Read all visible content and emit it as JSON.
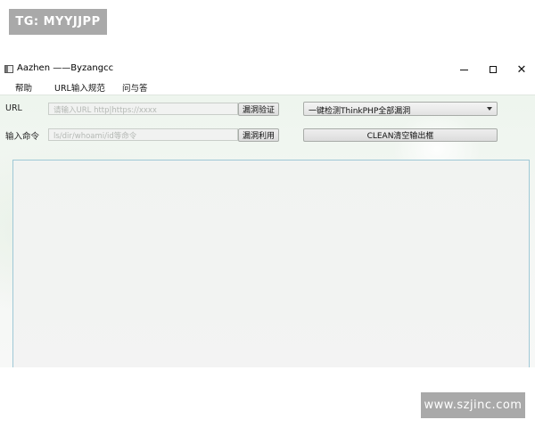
{
  "watermarks": {
    "top": "TG: MYYJJPP",
    "bottom": "www.szjinc.com"
  },
  "window": {
    "title": "Aazhen ——Byzangcc",
    "controls": {
      "minimize": "",
      "maximize": "",
      "close": "✕"
    }
  },
  "menu": {
    "items": [
      "帮助",
      "URL输入规范",
      "问与答"
    ]
  },
  "form": {
    "url_label": "URL",
    "url_placeholder": "请输入URL http|https://xxxx",
    "verify_button": "漏洞验证",
    "check_select_value": "一键检测ThinkPHP全部漏洞",
    "cmd_label": "输入命令",
    "cmd_placeholder": "ls/dir/whoami/id等命令",
    "exploit_button": "漏洞利用",
    "clean_button": "CLEAN清空输出框"
  },
  "output": {
    "text": ""
  }
}
